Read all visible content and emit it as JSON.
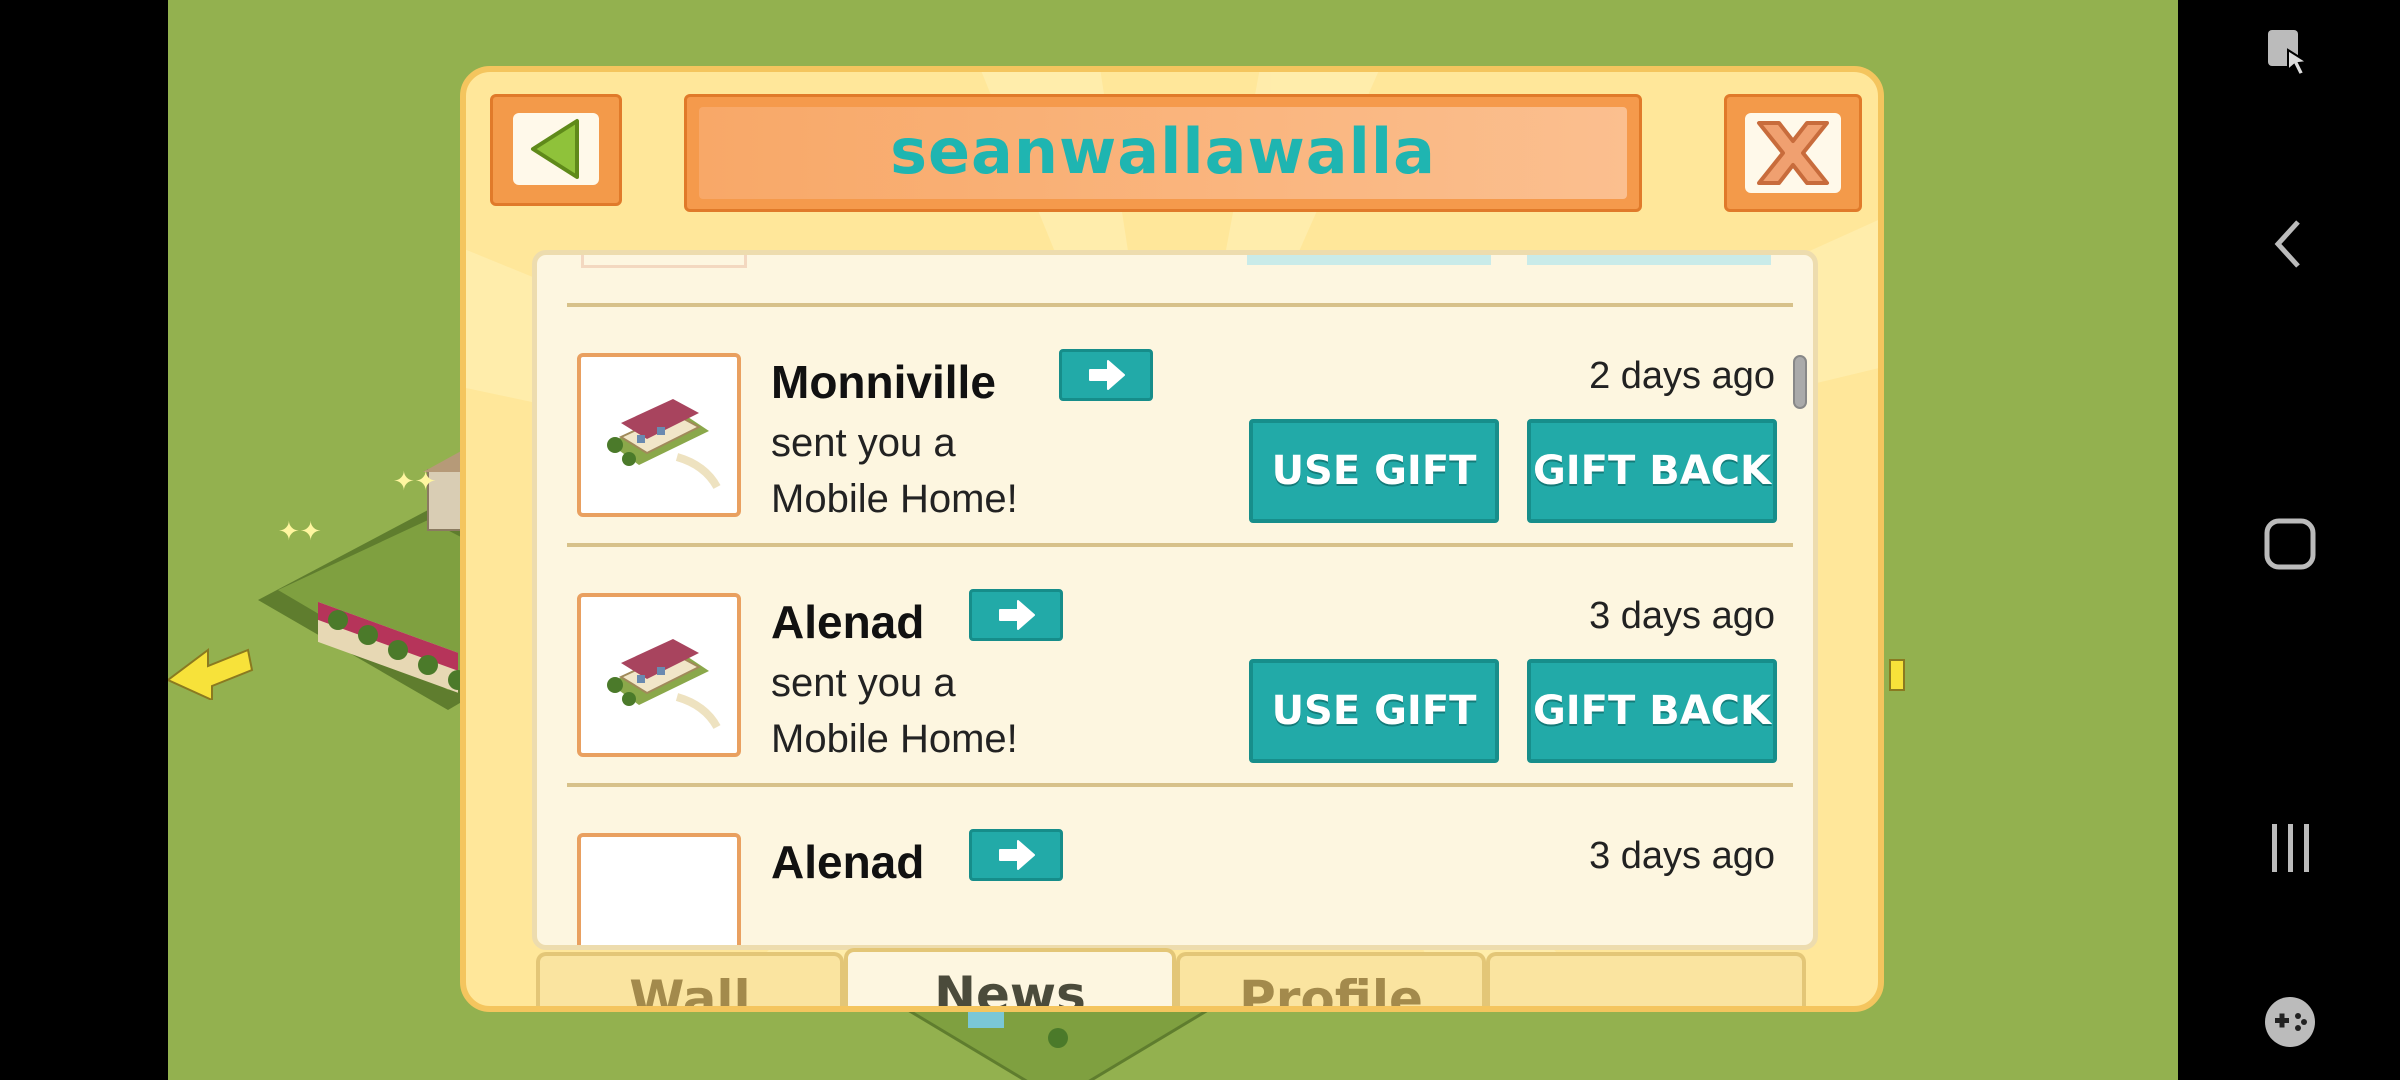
{
  "header": {
    "title": "seanwallawalla"
  },
  "items": [
    {
      "sender": "Monniville",
      "message": "sent you a Mobile Home!",
      "time": "2 days ago",
      "use_gift": "USE GIFT",
      "gift_back": "GIFT BACK"
    },
    {
      "sender": "Alenad",
      "message": "sent you a Mobile Home!",
      "time": "3 days ago",
      "use_gift": "USE GIFT",
      "gift_back": "GIFT BACK"
    },
    {
      "sender": "Alenad",
      "time": "3 days ago"
    }
  ],
  "tabs": [
    {
      "label": "Wall",
      "active": false
    },
    {
      "label": "News",
      "active": true
    },
    {
      "label": "Profile",
      "active": false
    }
  ],
  "colors": {
    "accent_teal": "#22aaa8",
    "panel_orange": "#f59a4c",
    "dialog_yellow": "#ffe79a",
    "game_green": "#93b14f"
  },
  "icons": [
    "back-arrow-icon",
    "close-x-icon",
    "mobile-home-icon",
    "arrow-right-icon",
    "screen-touch-icon",
    "nav-back-icon",
    "nav-home-icon",
    "nav-recents-icon",
    "game-controller-icon"
  ]
}
